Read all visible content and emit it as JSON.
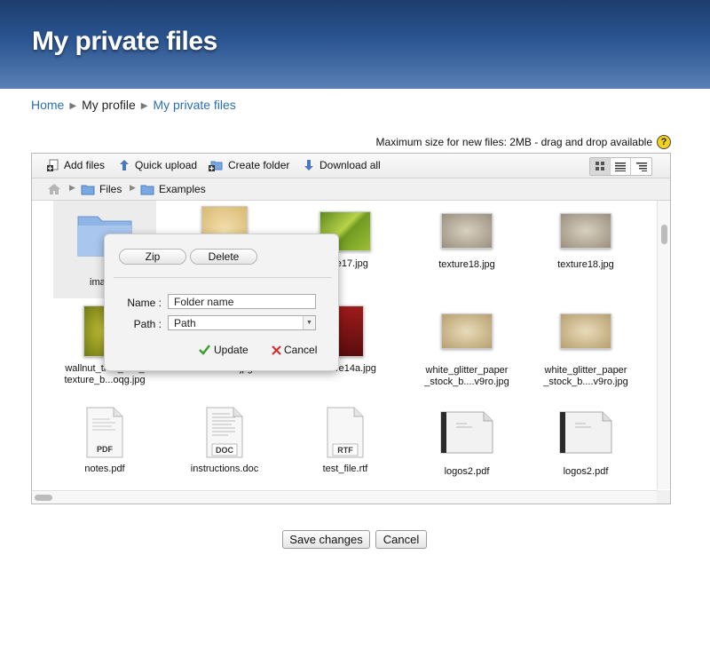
{
  "header": {
    "title": "My private files"
  },
  "breadcrumb": {
    "home": "Home",
    "profile": "My profile",
    "current": "My private files"
  },
  "maxsize": {
    "text": "Maximum size for new files: 2MB - drag and drop available",
    "help": "?"
  },
  "toolbar": {
    "add_files": "Add files",
    "quick_upload": "Quick upload",
    "create_folder": "Create folder",
    "download_all": "Download all"
  },
  "path": {
    "root": "Files",
    "current": "Examples"
  },
  "files": [
    {
      "name": "ima"
    },
    {
      "name": ""
    },
    {
      "name": "re17.jpg"
    },
    {
      "name": "texture18.jpg"
    },
    {
      "name": "texture18.jpg"
    },
    {
      "name": "wallnut_tree_leaf_\ntexture_b...oqg.jpg"
    },
    {
      "name": "texture19.jpg"
    },
    {
      "name": "texture14a.jpg"
    },
    {
      "name": "white_glitter_paper\n_stock_b....v9ro.jpg"
    },
    {
      "name": "white_glitter_paper\n_stock_b....v9ro.jpg"
    },
    {
      "name": "notes.pdf",
      "badge": "PDF"
    },
    {
      "name": "instructions.doc",
      "badge": "DOC"
    },
    {
      "name": "test_file.rtf",
      "badge": "RTF"
    },
    {
      "name": "logos2.pdf"
    },
    {
      "name": "logos2.pdf"
    }
  ],
  "popup": {
    "zip": "Zip",
    "delete": "Delete",
    "name_label": "Name :",
    "name_value": "Folder name",
    "path_label": "Path :",
    "path_value": "Path",
    "update": "Update",
    "cancel": "Cancel"
  },
  "actions": {
    "save": "Save changes",
    "cancel": "Cancel"
  },
  "colors": {
    "link": "#2a6fb0",
    "header_top": "#1d3d6d",
    "header_bottom": "#5a80b5",
    "update_check": "#3aa22a",
    "cancel_x": "#d42a2a"
  }
}
